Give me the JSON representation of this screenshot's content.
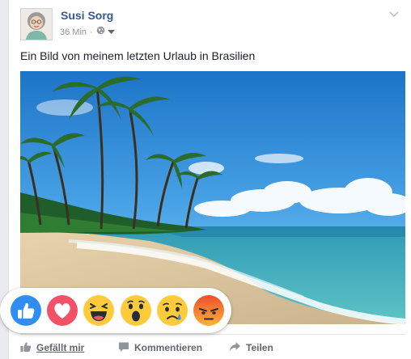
{
  "post": {
    "author": "Susi Sorg",
    "time": "36 Min",
    "separator": "·",
    "privacy_icon": "globe-icon",
    "text": "Ein Bild von meinem letzten Urlaub in Brasilien"
  },
  "reactions": [
    {
      "name": "like",
      "icon": "thumbs-up-icon",
      "color": "#2e8ef1"
    },
    {
      "name": "love",
      "icon": "heart-icon",
      "color": "#f25268"
    },
    {
      "name": "haha",
      "icon": "laughing-face-icon",
      "color": "#fecb3d"
    },
    {
      "name": "wow",
      "icon": "surprised-face-icon",
      "color": "#fecb3d"
    },
    {
      "name": "sad",
      "icon": "crying-face-icon",
      "color": "#fecb3d"
    },
    {
      "name": "angry",
      "icon": "angry-face-icon",
      "color": "#f26a2c"
    }
  ],
  "actions": {
    "like": "Gefällt mir",
    "comment": "Kommentieren",
    "share": "Teilen"
  },
  "colors": {
    "link": "#365899",
    "muted": "#90949c",
    "action": "#616770"
  }
}
